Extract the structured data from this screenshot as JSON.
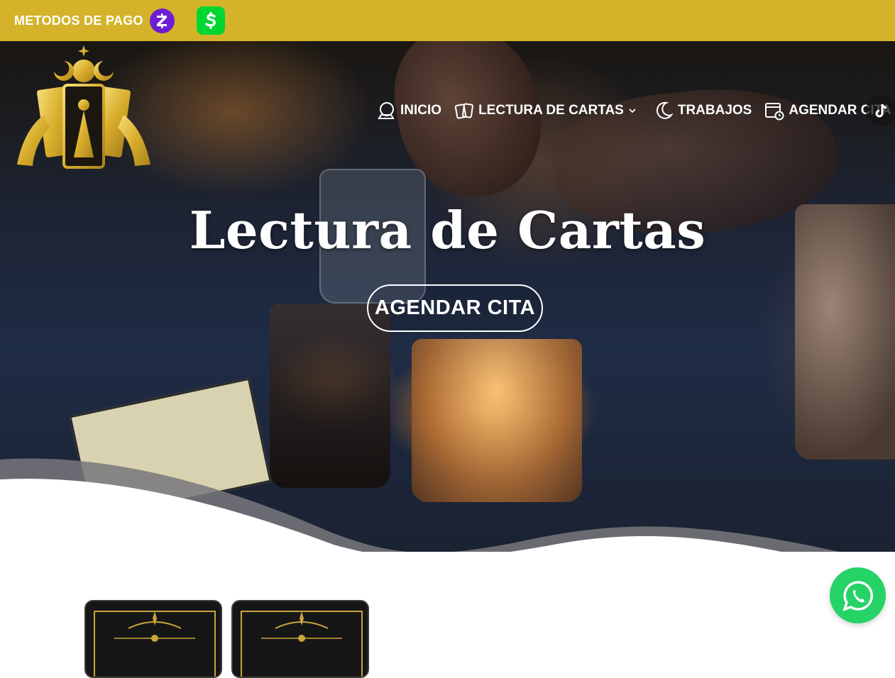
{
  "topbar": {
    "label": "METODOS DE PAGO",
    "payment_icons": [
      "zelle-icon",
      "cash-app-icon"
    ],
    "background": "#d4b32a"
  },
  "nav": {
    "items": [
      {
        "label": "INICIO",
        "icon": "crystal-ball-icon"
      },
      {
        "label": "LECTURA DE CARTAS",
        "icon": "tarot-cards-icon",
        "has_dropdown": true
      },
      {
        "label": "TRABAJOS",
        "icon": "crescent-moon-icon"
      },
      {
        "label": "AGENDAR CITA",
        "icon": "calendar-clock-icon"
      }
    ],
    "social": "tiktok-icon"
  },
  "hero": {
    "title": "Lectura de Cartas",
    "cta_label": "AGENDAR CITA"
  },
  "floating": {
    "chat": "whatsapp-icon",
    "chat_color": "#25d366"
  },
  "colors": {
    "gold": "#d4b32a",
    "zelle": "#6d1ed4",
    "cashapp": "#00d632"
  }
}
